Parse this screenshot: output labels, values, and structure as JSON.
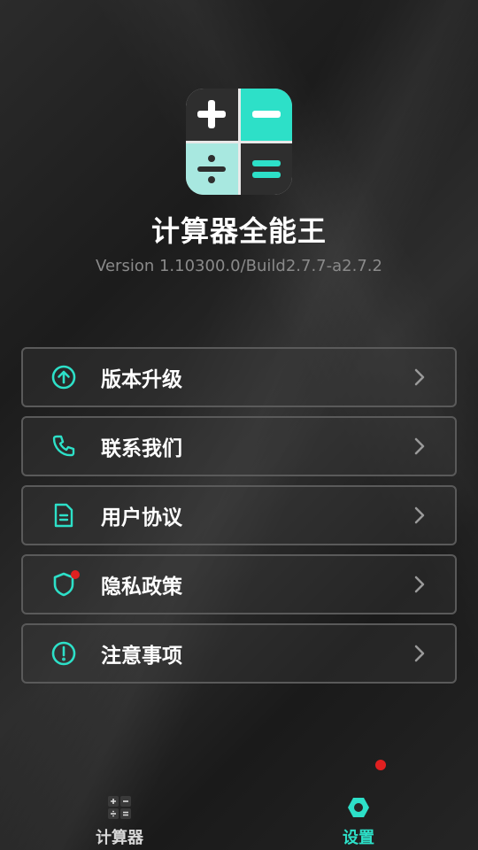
{
  "app": {
    "title": "计算器全能王",
    "version": "Version 1.10300.0/Build2.7.7-a2.7.2",
    "accent": "#2de0c8"
  },
  "menu": {
    "items": [
      {
        "label": "版本升级",
        "icon": "upload-circle-icon"
      },
      {
        "label": "联系我们",
        "icon": "phone-icon"
      },
      {
        "label": "用户协议",
        "icon": "document-icon"
      },
      {
        "label": "隐私政策",
        "icon": "shield-icon",
        "badge": true
      },
      {
        "label": "注意事项",
        "icon": "exclamation-circle-icon"
      }
    ]
  },
  "tabbar": {
    "calculator": {
      "label": "计算器",
      "icon": "calculator-icon"
    },
    "settings": {
      "label": "设置",
      "icon": "settings-hex-icon",
      "active": true,
      "badge": true
    }
  }
}
